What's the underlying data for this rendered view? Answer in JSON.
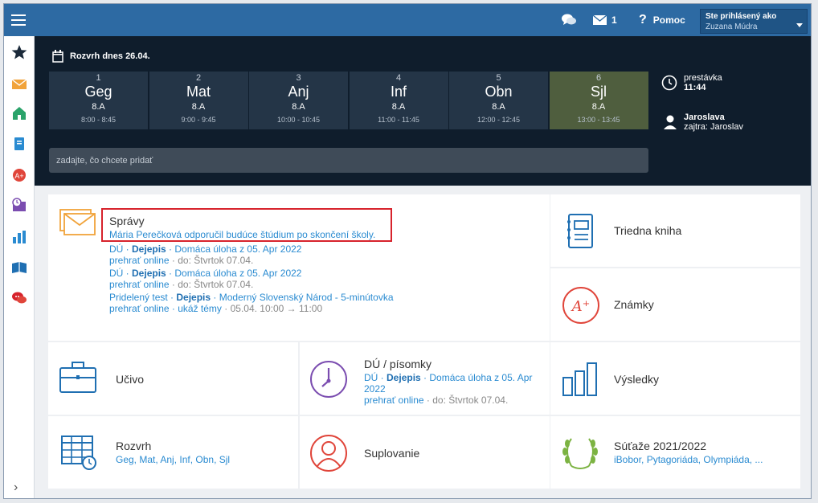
{
  "topbar": {
    "message_count": "1",
    "help_label": "Pomoc",
    "user_label": "Ste prihlásený ako",
    "user_name": "Zuzana Múdra"
  },
  "sidebar": {
    "icons": [
      "star-icon",
      "mail-icon",
      "home-icon",
      "notebook-icon",
      "grade-icon",
      "calendar-clock-icon",
      "chart-icon",
      "book-icon",
      "chat-icon"
    ]
  },
  "schedule": {
    "title": "Rozvrh dnes 26.04.",
    "lessons": [
      {
        "num": "1",
        "subject": "Geg",
        "class": "8.A",
        "time": "8:00 - 8:45"
      },
      {
        "num": "2",
        "subject": "Mat",
        "class": "8.A",
        "time": "9:00 - 9:45"
      },
      {
        "num": "3",
        "subject": "Anj",
        "class": "8.A",
        "time": "10:00 - 10:45"
      },
      {
        "num": "4",
        "subject": "Inf",
        "class": "8.A",
        "time": "11:00 - 11:45"
      },
      {
        "num": "5",
        "subject": "Obn",
        "class": "8.A",
        "time": "12:00 - 12:45"
      },
      {
        "num": "6",
        "subject": "Sjl",
        "class": "8.A",
        "time": "13:00 - 13:45"
      }
    ],
    "break_label": "prestávka",
    "break_time": "11:44",
    "nameday_today": "Jaroslava",
    "nameday_tomorrow": "zajtra: Jaroslav",
    "input_placeholder": "zadajte, čo chcete pridať"
  },
  "messages": {
    "title": "Správy",
    "latest": "Mária Perečková odporučil budúce štúdium po skončení školy.",
    "items": [
      {
        "type": "DÚ",
        "subject": "Dejepis",
        "text": "Domáca úloha z 05. Apr 2022",
        "action": "prehrať online",
        "extra": "do: Štvrtok 07.04."
      },
      {
        "type": "DÚ",
        "subject": "Dejepis",
        "text": "Domáca úloha z 05. Apr 2022",
        "action": "prehrať online",
        "extra": "do: Štvrtok 07.04."
      },
      {
        "type": "Pridelený test",
        "subject": "Dejepis",
        "text": "Moderný Slovenský Národ - 5-minútovka",
        "action": "prehrať online",
        "action2": "ukáž témy",
        "extra": "05.04. 10:00 → 11:00"
      }
    ]
  },
  "tiles": {
    "triedna_kniha": "Triedna kniha",
    "znamky": "Známky",
    "ucivo": "Učivo",
    "du_title": "DÚ / písomky",
    "du_type": "DÚ",
    "du_subject": "Dejepis",
    "du_text": "Domáca úloha z 05. Apr 2022",
    "du_action": "prehrať online",
    "du_extra": "do: Štvrtok 07.04.",
    "vysledky": "Výsledky",
    "rozvrh": "Rozvrh",
    "rozvrh_sub": "Geg, Mat, Anj, Inf, Obn, Sjl",
    "suplovanie": "Suplovanie",
    "sutaze": "Súťaže 2021/2022",
    "sutaze_sub": "iBobor, Pytagoriáda, Olympiáda, ..."
  },
  "colors": {
    "topbar": "#2d6aa3",
    "schedule_bg": "#0f1d2c",
    "lesson_bg": "#243547",
    "lesson_active": "#4f5e3e",
    "link": "#2a8bd1",
    "highlight": "#d7232c"
  }
}
